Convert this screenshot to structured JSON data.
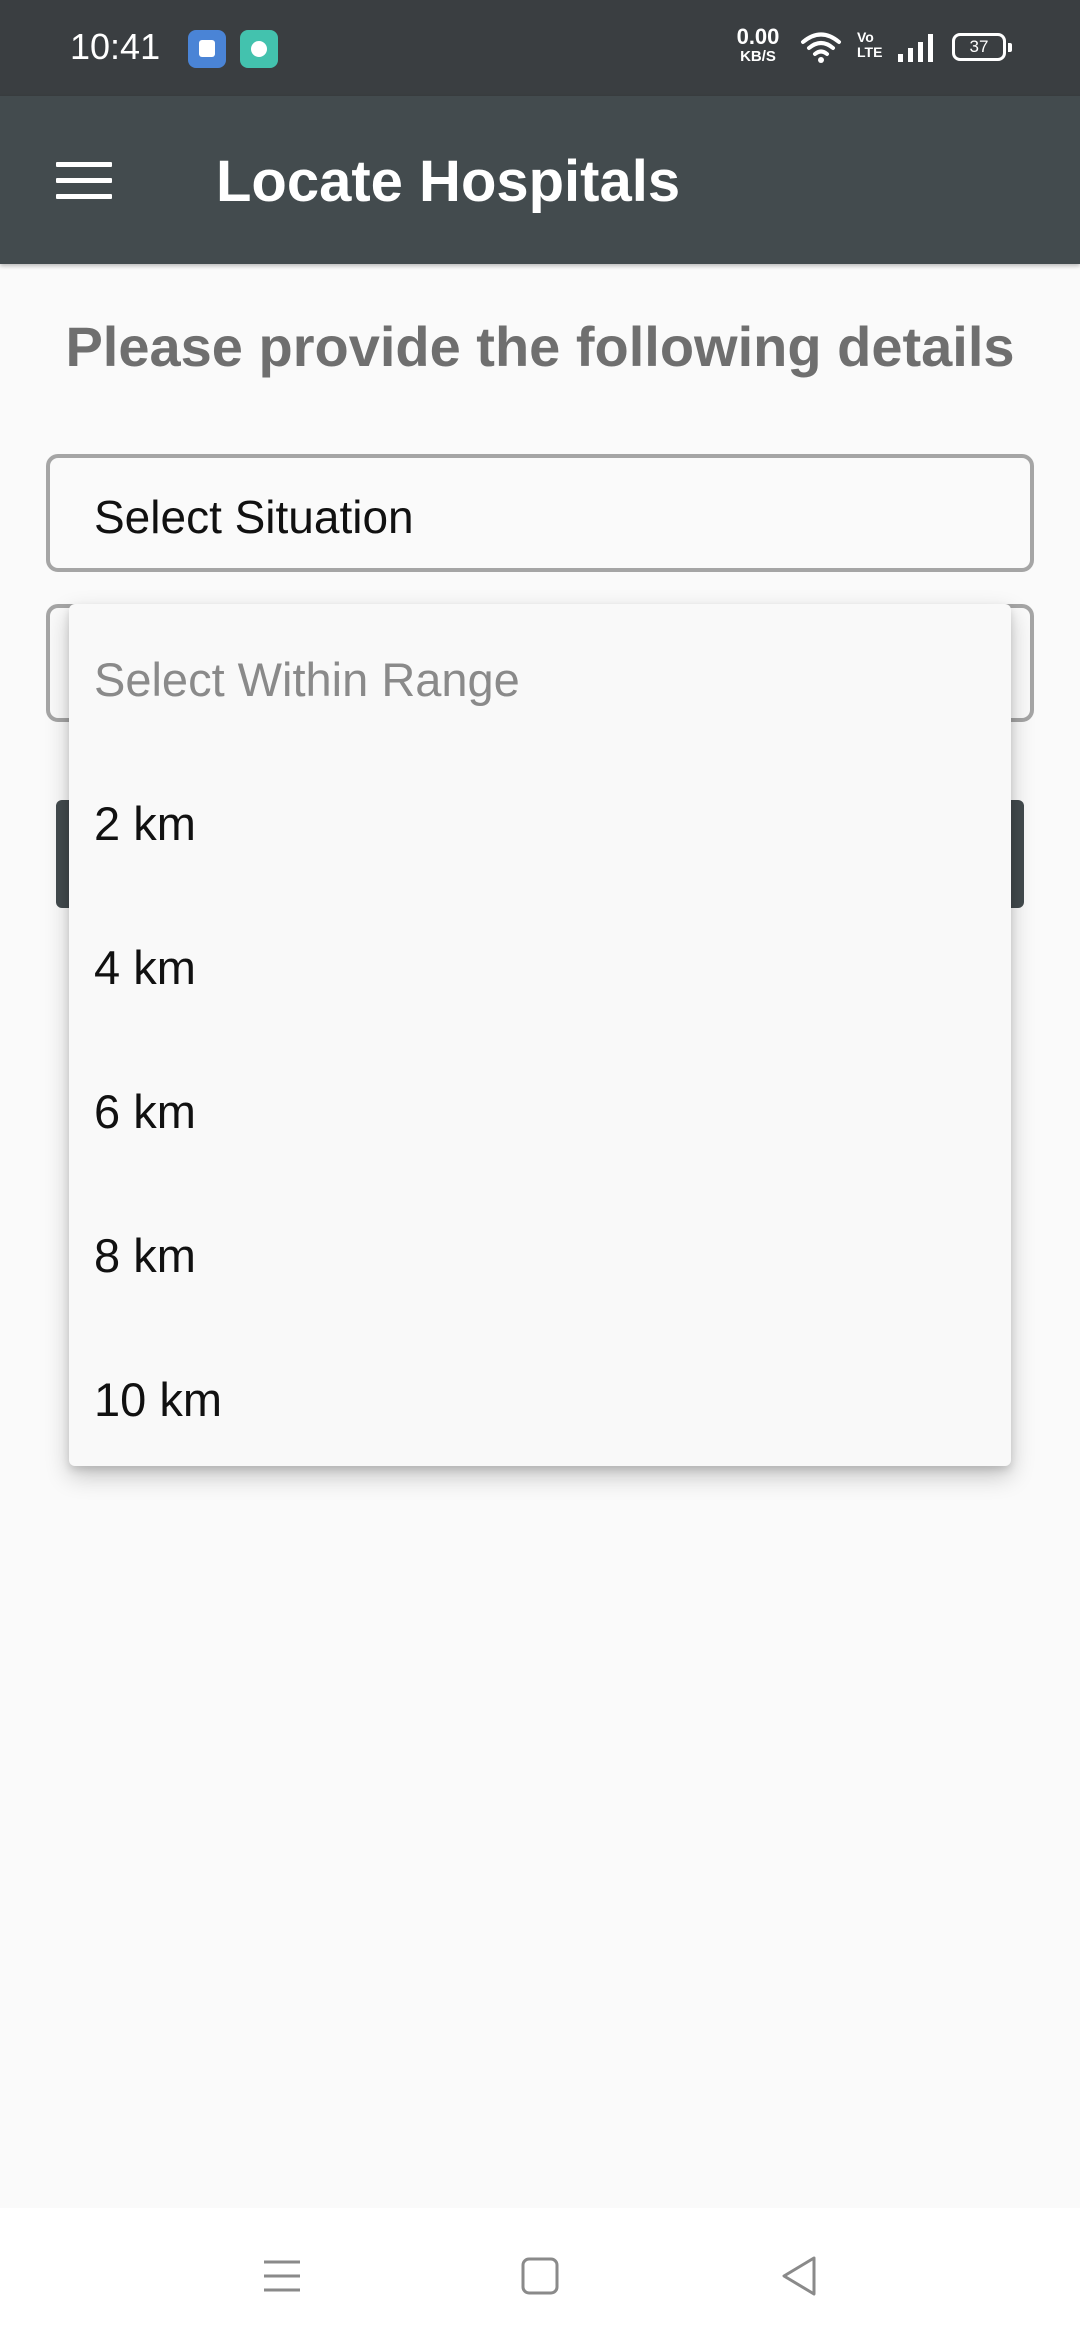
{
  "status_bar": {
    "time": "10:41",
    "net_speed_value": "0.00",
    "net_speed_unit": "KB/S",
    "volte_top": "Vo",
    "volte_bottom": "LTE",
    "battery": "37",
    "icons": [
      "app-notification-icon",
      "app-notification-icon-2",
      "wifi-icon",
      "signal-icon",
      "battery-icon"
    ]
  },
  "app_bar": {
    "title": "Locate Hospitals",
    "menu_icon": "hamburger-menu-icon"
  },
  "main": {
    "heading": "Please provide the following details",
    "situation_select": {
      "selected": "Select Situation"
    },
    "range_select": {
      "placeholder": "Select Within Range",
      "options": [
        "2 km",
        "4 km",
        "6 km",
        "8 km",
        "10 km"
      ]
    }
  },
  "nav_bar": {
    "icons": [
      "recents-icon",
      "home-icon",
      "back-icon"
    ]
  },
  "colors": {
    "status_bar": "#3a3e41",
    "app_bar": "#434b4e",
    "background": "#fafafa",
    "heading_text": "#6f6f6f"
  }
}
